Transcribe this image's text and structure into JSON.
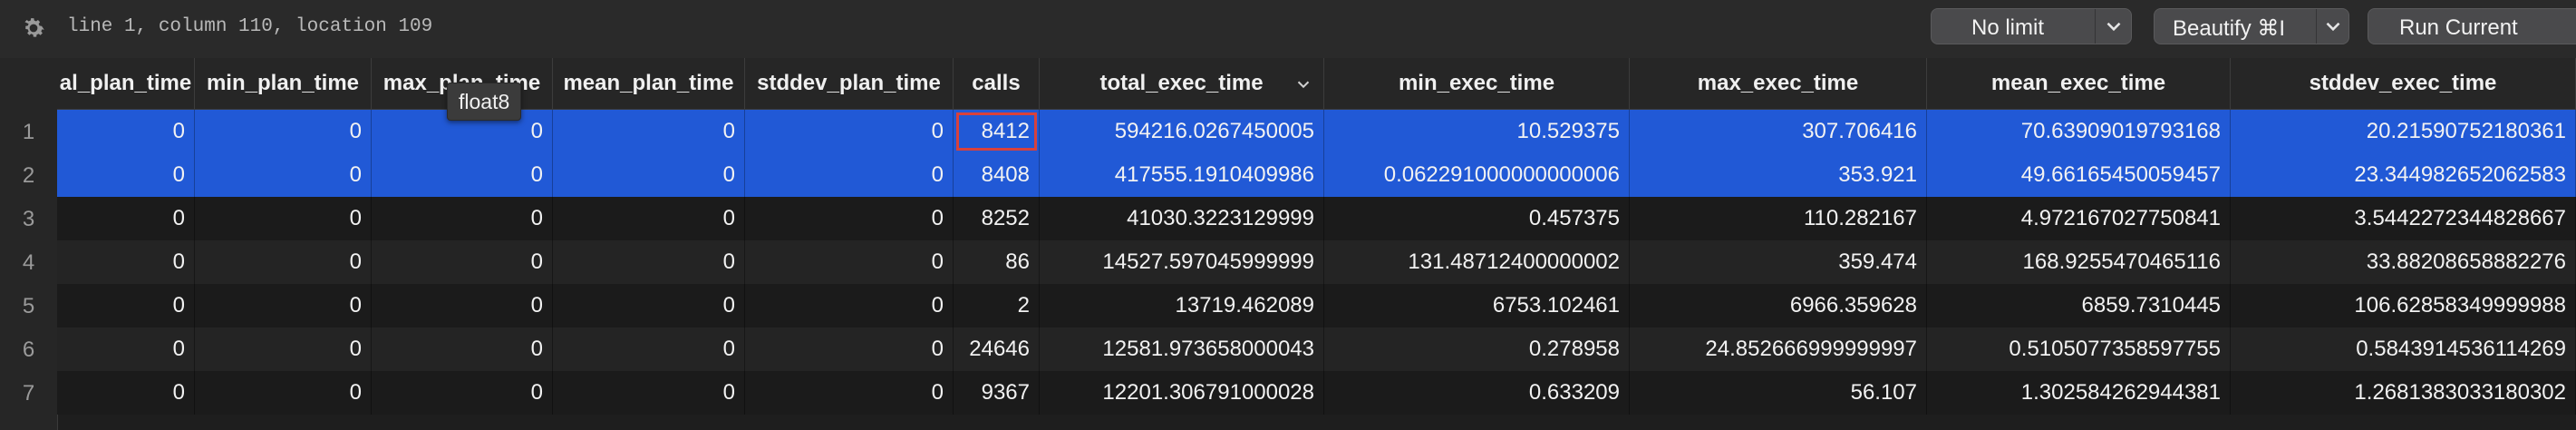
{
  "status": {
    "text": "line 1, column 110, location 109"
  },
  "toolbar": {
    "limit_label": "No limit",
    "beautify_label": "Beautify ⌘I",
    "run_label": "Run Current"
  },
  "tooltip": {
    "text": "float8"
  },
  "columns": [
    "al_plan_time",
    "min_plan_time",
    "max_plan_time",
    "mean_plan_time",
    "stddev_plan_time",
    "calls",
    "total_exec_time",
    "min_exec_time",
    "max_exec_time",
    "mean_exec_time",
    "stddev_exec_time"
  ],
  "rows": [
    {
      "num": "1",
      "cells": [
        "0",
        "0",
        "0",
        "0",
        "0",
        "8412",
        "594216.0267450005",
        "10.529375",
        "307.706416",
        "70.63909019793168",
        "20.21590752180361"
      ]
    },
    {
      "num": "2",
      "cells": [
        "0",
        "0",
        "0",
        "0",
        "0",
        "8408",
        "417555.1910409986",
        "0.062291000000000006",
        "353.921",
        "49.66165450059457",
        "23.344982652062583"
      ]
    },
    {
      "num": "3",
      "cells": [
        "0",
        "0",
        "0",
        "0",
        "0",
        "8252",
        "41030.3223129999",
        "0.457375",
        "110.282167",
        "4.972167027750841",
        "3.5442272344828667"
      ]
    },
    {
      "num": "4",
      "cells": [
        "0",
        "0",
        "0",
        "0",
        "0",
        "86",
        "14527.597045999999",
        "131.48712400000002",
        "359.474",
        "168.9255470465116",
        "33.88208658882276"
      ]
    },
    {
      "num": "5",
      "cells": [
        "0",
        "0",
        "0",
        "0",
        "0",
        "2",
        "13719.462089",
        "6753.102461",
        "6966.359628",
        "6859.7310445",
        "106.62858349999988"
      ]
    },
    {
      "num": "6",
      "cells": [
        "0",
        "0",
        "0",
        "0",
        "0",
        "24646",
        "12581.973658000043",
        "0.278958",
        "24.852666999999997",
        "0.5105077358597755",
        "0.5843914536114269"
      ]
    },
    {
      "num": "7",
      "cells": [
        "0",
        "0",
        "0",
        "0",
        "0",
        "9367",
        "12201.306791000028",
        "0.633209",
        "56.107",
        "1.302584262944381",
        "1.2681383033180302"
      ]
    }
  ]
}
